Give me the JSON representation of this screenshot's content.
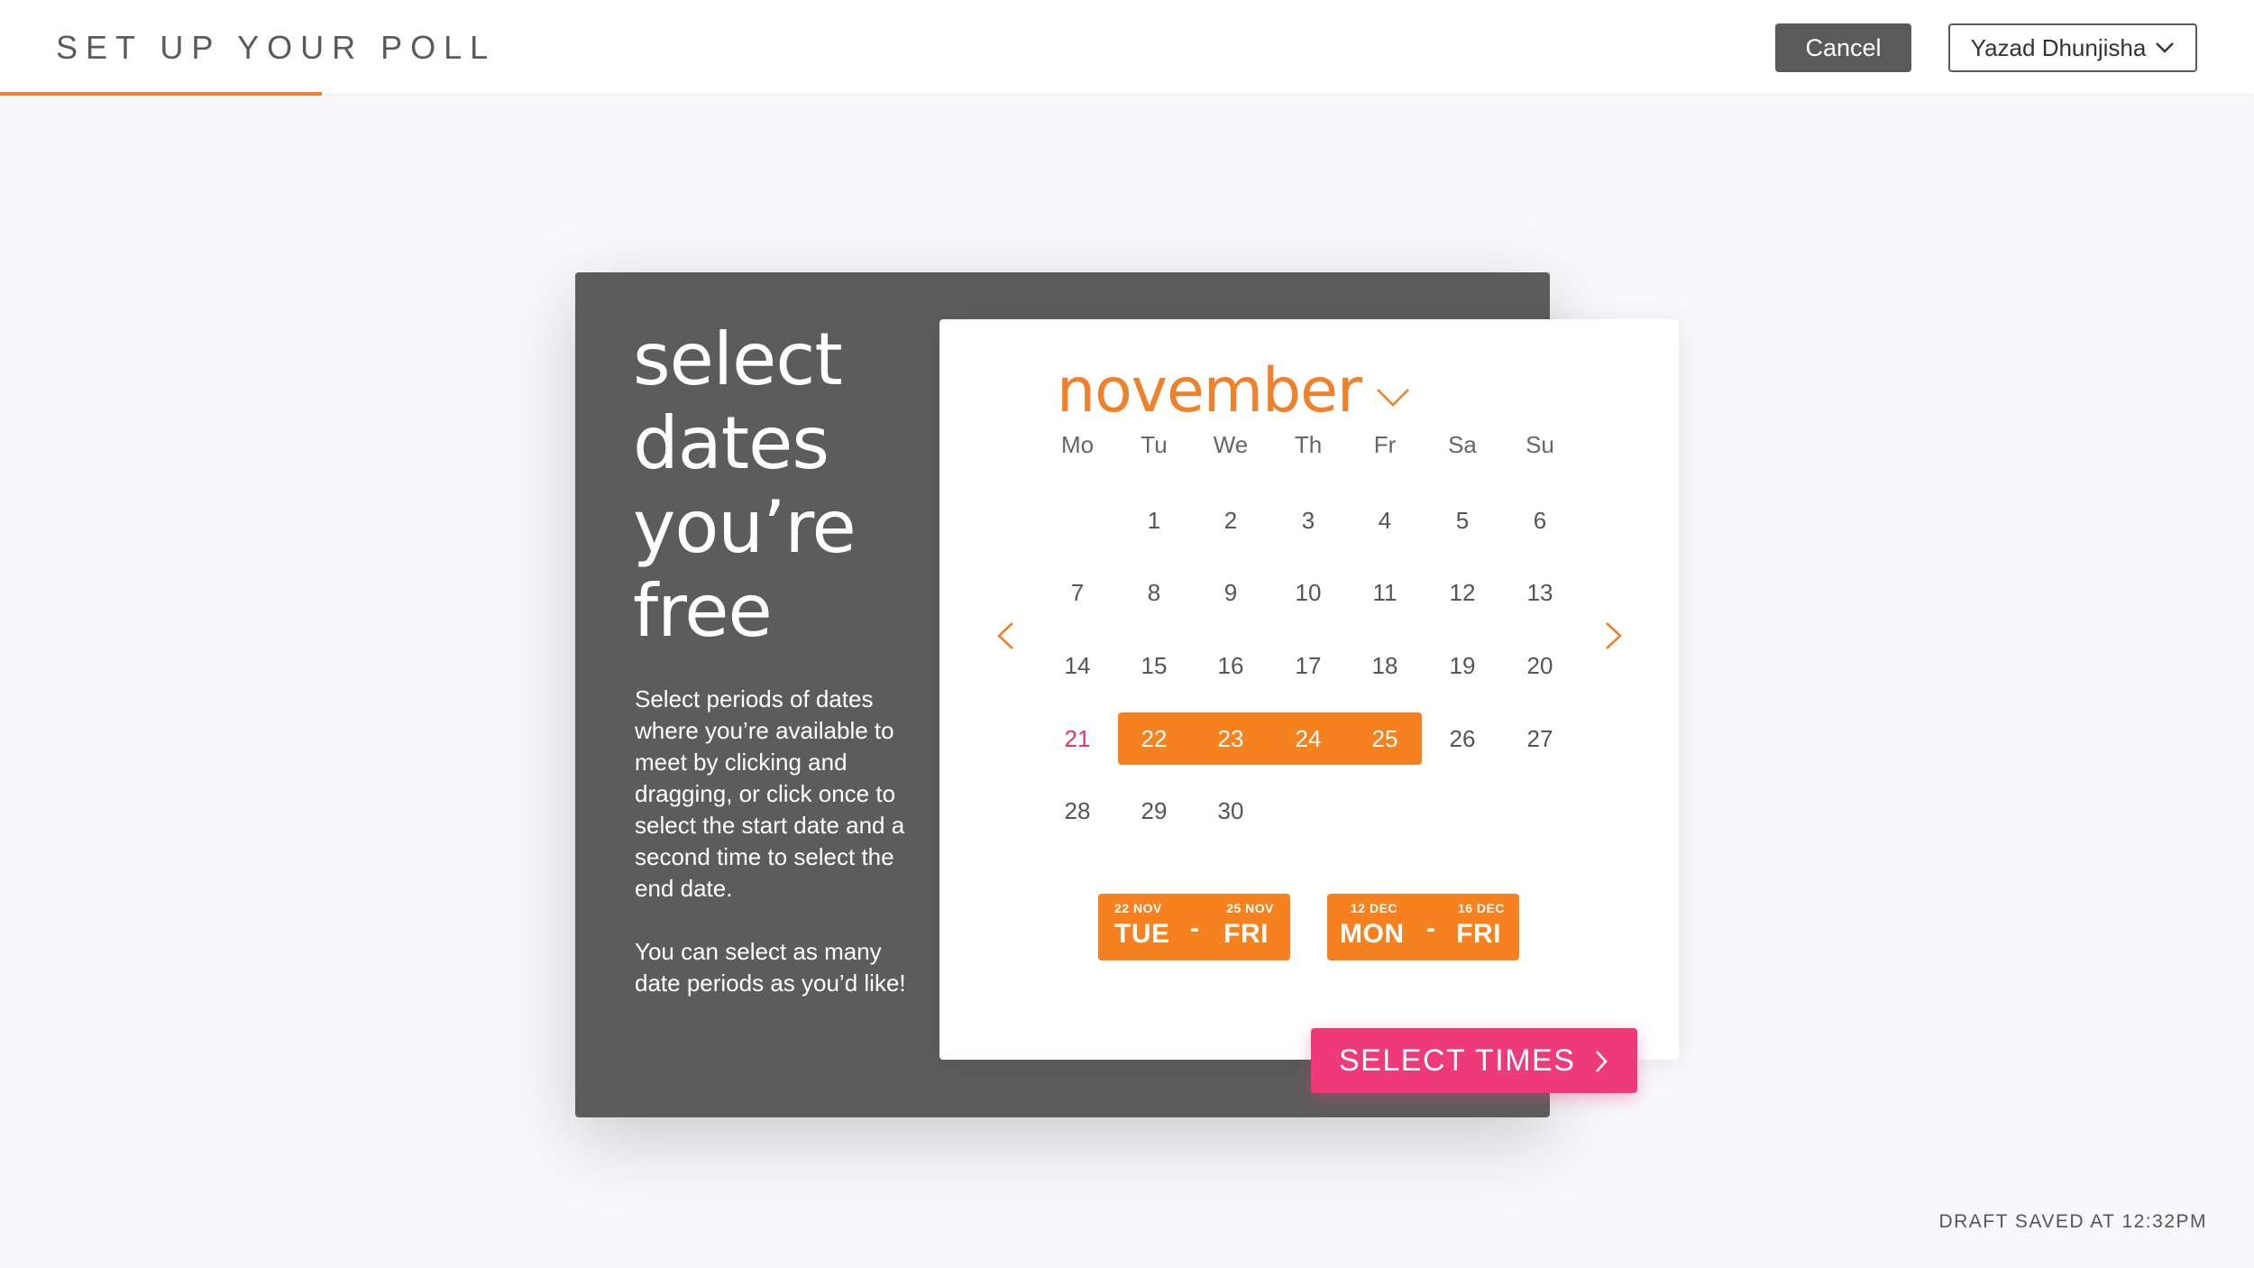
{
  "header": {
    "title": "SET UP YOUR POLL",
    "cancel_label": "Cancel",
    "user_name": "Yazad Dhunjisha",
    "accent_color": "#f0812a"
  },
  "intro": {
    "headline": [
      "select",
      "dates",
      "you’re",
      "free"
    ],
    "description": [
      "Select periods of dates where you’re available to meet by clicking and dragging, or click once to select the start date and a second time to select the end date.",
      "You can select as many date periods as you’d like!"
    ]
  },
  "calendar": {
    "month": "november",
    "weekdays": [
      "Mo",
      "Tu",
      "We",
      "Th",
      "Fr",
      "Sa",
      "Su"
    ],
    "weeks": [
      [
        "",
        "1",
        "2",
        "3",
        "4",
        "5",
        "6"
      ],
      [
        "7",
        "8",
        "9",
        "10",
        "11",
        "12",
        "13"
      ],
      [
        "14",
        "15",
        "16",
        "17",
        "18",
        "19",
        "20"
      ],
      [
        "21",
        "22",
        "23",
        "24",
        "25",
        "26",
        "27"
      ],
      [
        "28",
        "29",
        "30",
        "",
        "",
        "",
        ""
      ]
    ],
    "today": "21",
    "selected": [
      "22",
      "23",
      "24",
      "25"
    ],
    "selection_color": "#f5821f",
    "today_color": "#e8336d"
  },
  "periods": [
    {
      "start_date": "22 NOV",
      "start_day": "TUE",
      "end_date": "25 NOV",
      "end_day": "FRI"
    },
    {
      "start_date": "12 DEC",
      "start_day": "MON",
      "end_date": "16 DEC",
      "end_day": "FRI"
    }
  ],
  "actions": {
    "select_times_label": "SELECT TIMES",
    "select_times_color": "#ee3a78"
  },
  "footer": {
    "draft_status": "DRAFT SAVED AT 12:32PM"
  }
}
